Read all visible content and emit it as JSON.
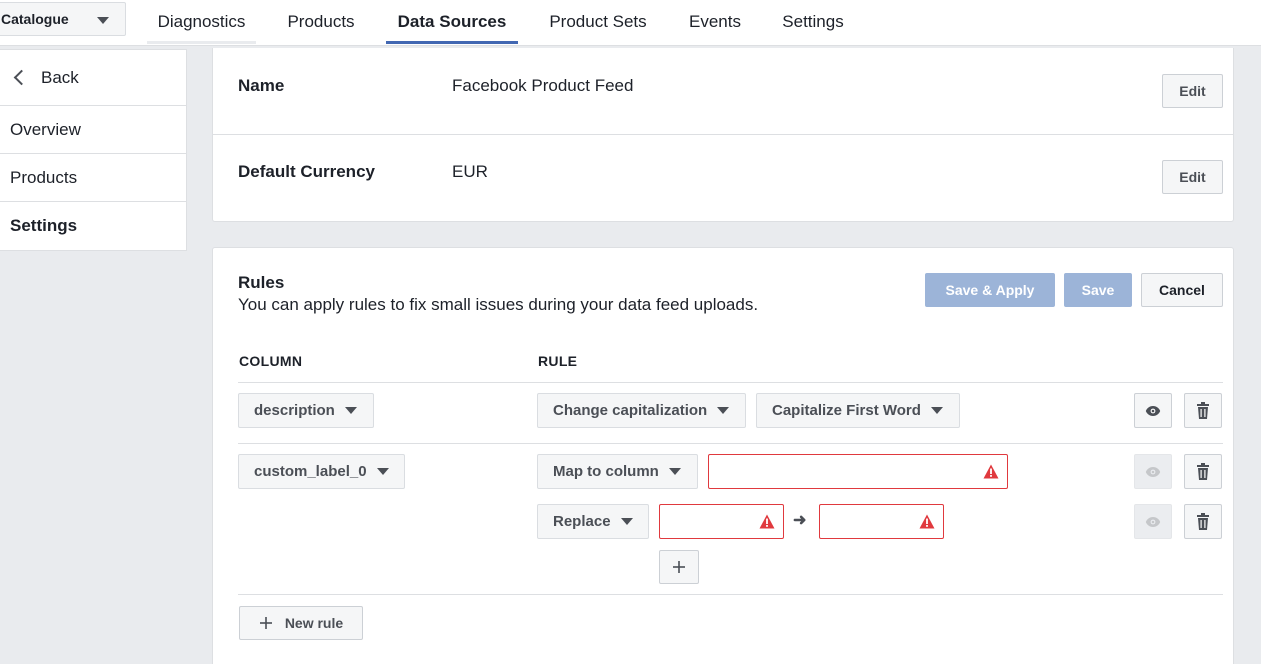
{
  "catalogue": {
    "label": "Catalogue"
  },
  "tabs": [
    {
      "label": "Diagnostics"
    },
    {
      "label": "Products"
    },
    {
      "label": "Data Sources"
    },
    {
      "label": "Product Sets"
    },
    {
      "label": "Events"
    },
    {
      "label": "Settings"
    }
  ],
  "active_tab": "Data Sources",
  "sidebar": {
    "back": "Back",
    "items": [
      {
        "label": "Overview"
      },
      {
        "label": "Products"
      },
      {
        "label": "Settings"
      }
    ],
    "active_item": "Settings"
  },
  "properties": {
    "name_label": "Name",
    "name_value": "Facebook Product Feed",
    "currency_label": "Default Currency",
    "currency_value": "EUR",
    "edit_label": "Edit"
  },
  "rules": {
    "title": "Rules",
    "description": "You can apply rules to fix small issues during your data feed uploads.",
    "save_apply": "Save & Apply",
    "save": "Save",
    "cancel": "Cancel",
    "column_header": "COLUMN",
    "rule_header": "RULE",
    "rows": [
      {
        "column": "description",
        "rule": "Change capitalization",
        "option": "Capitalize First Word"
      },
      {
        "column": "custom_label_0",
        "rule": "Map to column",
        "rule2": "Replace"
      }
    ],
    "new_rule": "New rule"
  },
  "colors": {
    "accent": "#4267b2",
    "error": "#e0393e",
    "disabled_primary": "#9cb4d8"
  }
}
